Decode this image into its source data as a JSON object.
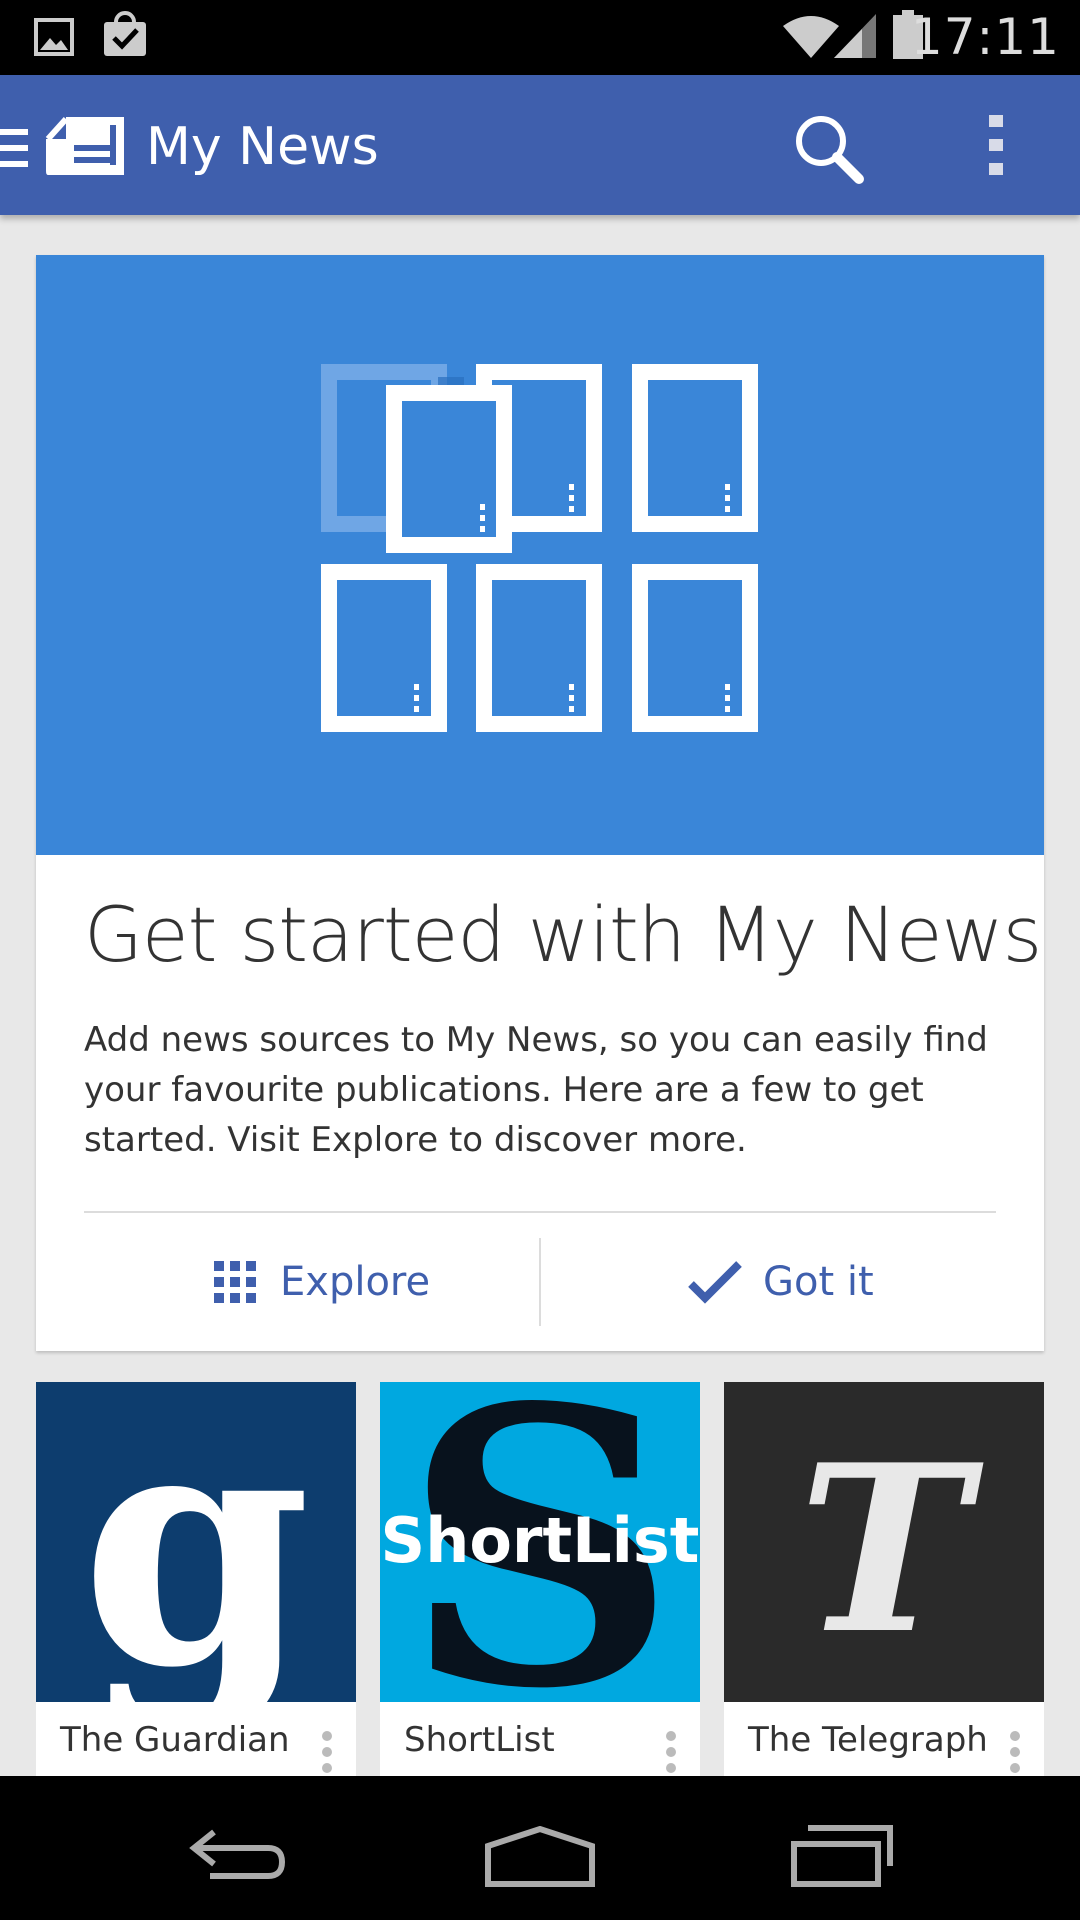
{
  "status_bar": {
    "time": "17:11",
    "icons": [
      "image-notification-icon",
      "shopping-bag-check-icon",
      "wifi-icon",
      "cell-signal-icon",
      "battery-icon"
    ]
  },
  "app_bar": {
    "title": "My News",
    "background": "#3f5fad",
    "icons": [
      "menu-icon",
      "newspaper-icon",
      "search-icon",
      "overflow-menu-icon"
    ]
  },
  "intro_card": {
    "title": "Get started with My News",
    "body": "Add news sources to My News, so you can easily find your favourite publications. Here are a few to get started. Visit Explore to discover more.",
    "hero_color": "#3a86d8",
    "actions": [
      {
        "label": "Explore",
        "icon": "grid-icon"
      },
      {
        "label": "Got it",
        "icon": "checkmark-icon"
      }
    ]
  },
  "sources": [
    {
      "name": "The Guardian",
      "logo_text": "g",
      "color": "#0d3d6e"
    },
    {
      "name": "ShortList",
      "logo_text": "ShortList",
      "color": "#00a8e0"
    },
    {
      "name": "The Telegraph",
      "logo_text": "T",
      "color": "#2a2a2a"
    }
  ],
  "nav_bar": {
    "icons": [
      "back-icon",
      "home-icon",
      "recents-icon"
    ]
  }
}
